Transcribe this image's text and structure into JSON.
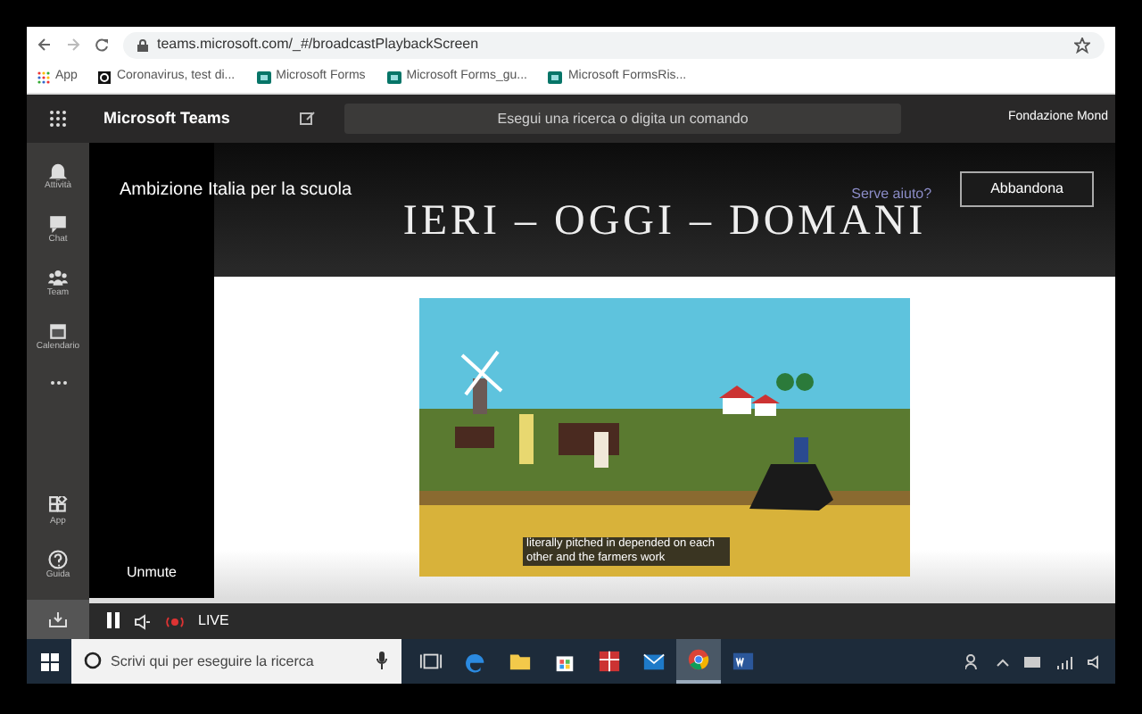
{
  "browser": {
    "url": "teams.microsoft.com/_#/broadcastPlaybackScreen",
    "bookmarks": [
      {
        "kind": "apps",
        "label": "App"
      },
      {
        "kind": "site",
        "label": "Coronavirus, test di..."
      },
      {
        "kind": "forms",
        "label": "Microsoft Forms"
      },
      {
        "kind": "forms",
        "label": "Microsoft Forms_gu..."
      },
      {
        "kind": "forms",
        "label": "Microsoft FormsRis..."
      }
    ]
  },
  "teams_header": {
    "app_name": "Microsoft Teams",
    "search": {
      "placeholder": "Esegui una ricerca o digita un comando"
    },
    "account": "Fondazione Mond"
  },
  "rail": {
    "items": [
      {
        "kind": "bell",
        "label": "Attività"
      },
      {
        "kind": "chat",
        "label": "Chat"
      },
      {
        "kind": "team",
        "label": "Team"
      },
      {
        "kind": "calendar",
        "label": "Calendario"
      }
    ],
    "bottom_items": [
      {
        "kind": "apps",
        "label": "App"
      },
      {
        "kind": "help",
        "label": "Guida"
      }
    ]
  },
  "event": {
    "title": "Ambizione Italia per la scuola",
    "help_link": "Serve aiuto?",
    "leave_button": "Abbandona",
    "unmute": "Unmute"
  },
  "slide": {
    "title": "IERI – OGGI – DOMANI",
    "caption": "literally pitched in depended on each other and the farmers work"
  },
  "player": {
    "playing": true,
    "live": "LIVE"
  },
  "taskbar": {
    "search": {
      "placeholder": "Scrivi qui per eseguire la ricerca"
    },
    "apps": [
      {
        "kind": "taskview",
        "active": false
      },
      {
        "kind": "edge",
        "active": false
      },
      {
        "kind": "folder",
        "active": false
      },
      {
        "kind": "store",
        "active": false
      },
      {
        "kind": "gift",
        "active": false
      },
      {
        "kind": "mail",
        "active": false
      },
      {
        "kind": "chrome",
        "active": true
      },
      {
        "kind": "word",
        "active": false
      }
    ]
  }
}
